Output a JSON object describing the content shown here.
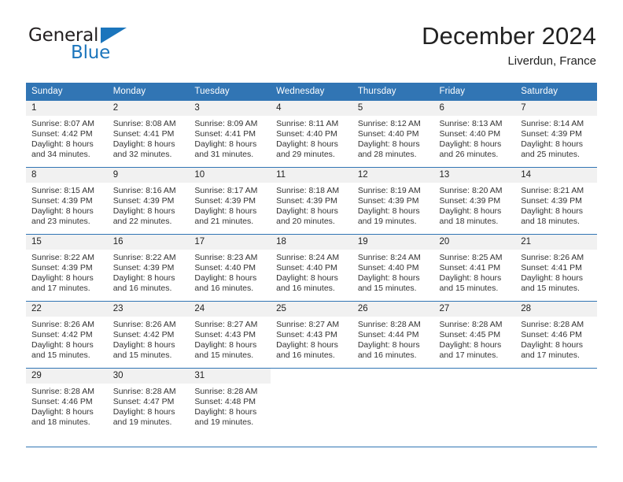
{
  "brand": {
    "name_top": "General",
    "name_bottom": "Blue",
    "triangle_icon": "triangle-icon",
    "accent_color": "#1b75bc"
  },
  "header": {
    "title": "December 2024",
    "location": "Liverdun, France"
  },
  "calendar": {
    "header_color": "#3175b4",
    "daynum_band_color": "#f1f1f1",
    "columns": [
      "Sunday",
      "Monday",
      "Tuesday",
      "Wednesday",
      "Thursday",
      "Friday",
      "Saturday"
    ],
    "weeks": [
      [
        {
          "day": "1",
          "sunrise": "Sunrise: 8:07 AM",
          "sunset": "Sunset: 4:42 PM",
          "daylight1": "Daylight: 8 hours",
          "daylight2": "and 34 minutes."
        },
        {
          "day": "2",
          "sunrise": "Sunrise: 8:08 AM",
          "sunset": "Sunset: 4:41 PM",
          "daylight1": "Daylight: 8 hours",
          "daylight2": "and 32 minutes."
        },
        {
          "day": "3",
          "sunrise": "Sunrise: 8:09 AM",
          "sunset": "Sunset: 4:41 PM",
          "daylight1": "Daylight: 8 hours",
          "daylight2": "and 31 minutes."
        },
        {
          "day": "4",
          "sunrise": "Sunrise: 8:11 AM",
          "sunset": "Sunset: 4:40 PM",
          "daylight1": "Daylight: 8 hours",
          "daylight2": "and 29 minutes."
        },
        {
          "day": "5",
          "sunrise": "Sunrise: 8:12 AM",
          "sunset": "Sunset: 4:40 PM",
          "daylight1": "Daylight: 8 hours",
          "daylight2": "and 28 minutes."
        },
        {
          "day": "6",
          "sunrise": "Sunrise: 8:13 AM",
          "sunset": "Sunset: 4:40 PM",
          "daylight1": "Daylight: 8 hours",
          "daylight2": "and 26 minutes."
        },
        {
          "day": "7",
          "sunrise": "Sunrise: 8:14 AM",
          "sunset": "Sunset: 4:39 PM",
          "daylight1": "Daylight: 8 hours",
          "daylight2": "and 25 minutes."
        }
      ],
      [
        {
          "day": "8",
          "sunrise": "Sunrise: 8:15 AM",
          "sunset": "Sunset: 4:39 PM",
          "daylight1": "Daylight: 8 hours",
          "daylight2": "and 23 minutes."
        },
        {
          "day": "9",
          "sunrise": "Sunrise: 8:16 AM",
          "sunset": "Sunset: 4:39 PM",
          "daylight1": "Daylight: 8 hours",
          "daylight2": "and 22 minutes."
        },
        {
          "day": "10",
          "sunrise": "Sunrise: 8:17 AM",
          "sunset": "Sunset: 4:39 PM",
          "daylight1": "Daylight: 8 hours",
          "daylight2": "and 21 minutes."
        },
        {
          "day": "11",
          "sunrise": "Sunrise: 8:18 AM",
          "sunset": "Sunset: 4:39 PM",
          "daylight1": "Daylight: 8 hours",
          "daylight2": "and 20 minutes."
        },
        {
          "day": "12",
          "sunrise": "Sunrise: 8:19 AM",
          "sunset": "Sunset: 4:39 PM",
          "daylight1": "Daylight: 8 hours",
          "daylight2": "and 19 minutes."
        },
        {
          "day": "13",
          "sunrise": "Sunrise: 8:20 AM",
          "sunset": "Sunset: 4:39 PM",
          "daylight1": "Daylight: 8 hours",
          "daylight2": "and 18 minutes."
        },
        {
          "day": "14",
          "sunrise": "Sunrise: 8:21 AM",
          "sunset": "Sunset: 4:39 PM",
          "daylight1": "Daylight: 8 hours",
          "daylight2": "and 18 minutes."
        }
      ],
      [
        {
          "day": "15",
          "sunrise": "Sunrise: 8:22 AM",
          "sunset": "Sunset: 4:39 PM",
          "daylight1": "Daylight: 8 hours",
          "daylight2": "and 17 minutes."
        },
        {
          "day": "16",
          "sunrise": "Sunrise: 8:22 AM",
          "sunset": "Sunset: 4:39 PM",
          "daylight1": "Daylight: 8 hours",
          "daylight2": "and 16 minutes."
        },
        {
          "day": "17",
          "sunrise": "Sunrise: 8:23 AM",
          "sunset": "Sunset: 4:40 PM",
          "daylight1": "Daylight: 8 hours",
          "daylight2": "and 16 minutes."
        },
        {
          "day": "18",
          "sunrise": "Sunrise: 8:24 AM",
          "sunset": "Sunset: 4:40 PM",
          "daylight1": "Daylight: 8 hours",
          "daylight2": "and 16 minutes."
        },
        {
          "day": "19",
          "sunrise": "Sunrise: 8:24 AM",
          "sunset": "Sunset: 4:40 PM",
          "daylight1": "Daylight: 8 hours",
          "daylight2": "and 15 minutes."
        },
        {
          "day": "20",
          "sunrise": "Sunrise: 8:25 AM",
          "sunset": "Sunset: 4:41 PM",
          "daylight1": "Daylight: 8 hours",
          "daylight2": "and 15 minutes."
        },
        {
          "day": "21",
          "sunrise": "Sunrise: 8:26 AM",
          "sunset": "Sunset: 4:41 PM",
          "daylight1": "Daylight: 8 hours",
          "daylight2": "and 15 minutes."
        }
      ],
      [
        {
          "day": "22",
          "sunrise": "Sunrise: 8:26 AM",
          "sunset": "Sunset: 4:42 PM",
          "daylight1": "Daylight: 8 hours",
          "daylight2": "and 15 minutes."
        },
        {
          "day": "23",
          "sunrise": "Sunrise: 8:26 AM",
          "sunset": "Sunset: 4:42 PM",
          "daylight1": "Daylight: 8 hours",
          "daylight2": "and 15 minutes."
        },
        {
          "day": "24",
          "sunrise": "Sunrise: 8:27 AM",
          "sunset": "Sunset: 4:43 PM",
          "daylight1": "Daylight: 8 hours",
          "daylight2": "and 15 minutes."
        },
        {
          "day": "25",
          "sunrise": "Sunrise: 8:27 AM",
          "sunset": "Sunset: 4:43 PM",
          "daylight1": "Daylight: 8 hours",
          "daylight2": "and 16 minutes."
        },
        {
          "day": "26",
          "sunrise": "Sunrise: 8:28 AM",
          "sunset": "Sunset: 4:44 PM",
          "daylight1": "Daylight: 8 hours",
          "daylight2": "and 16 minutes."
        },
        {
          "day": "27",
          "sunrise": "Sunrise: 8:28 AM",
          "sunset": "Sunset: 4:45 PM",
          "daylight1": "Daylight: 8 hours",
          "daylight2": "and 17 minutes."
        },
        {
          "day": "28",
          "sunrise": "Sunrise: 8:28 AM",
          "sunset": "Sunset: 4:46 PM",
          "daylight1": "Daylight: 8 hours",
          "daylight2": "and 17 minutes."
        }
      ],
      [
        {
          "day": "29",
          "sunrise": "Sunrise: 8:28 AM",
          "sunset": "Sunset: 4:46 PM",
          "daylight1": "Daylight: 8 hours",
          "daylight2": "and 18 minutes."
        },
        {
          "day": "30",
          "sunrise": "Sunrise: 8:28 AM",
          "sunset": "Sunset: 4:47 PM",
          "daylight1": "Daylight: 8 hours",
          "daylight2": "and 19 minutes."
        },
        {
          "day": "31",
          "sunrise": "Sunrise: 8:28 AM",
          "sunset": "Sunset: 4:48 PM",
          "daylight1": "Daylight: 8 hours",
          "daylight2": "and 19 minutes."
        },
        {
          "day": "",
          "sunrise": "",
          "sunset": "",
          "daylight1": "",
          "daylight2": ""
        },
        {
          "day": "",
          "sunrise": "",
          "sunset": "",
          "daylight1": "",
          "daylight2": ""
        },
        {
          "day": "",
          "sunrise": "",
          "sunset": "",
          "daylight1": "",
          "daylight2": ""
        },
        {
          "day": "",
          "sunrise": "",
          "sunset": "",
          "daylight1": "",
          "daylight2": ""
        }
      ]
    ]
  }
}
